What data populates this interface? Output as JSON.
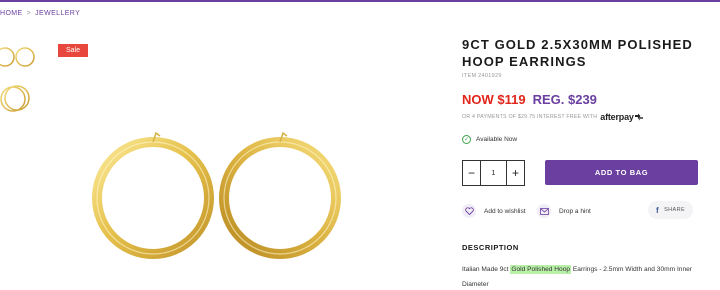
{
  "breadcrumb": {
    "home": "HOME",
    "separator": ">",
    "category": "JEWELLERY"
  },
  "badge": {
    "sale": "Sale"
  },
  "product": {
    "title": "9CT GOLD 2.5X30MM POLISHED HOOP EARRINGS",
    "item_number": "ITEM 2401929",
    "price_now": "NOW $119",
    "price_reg": "REG. $239",
    "afterpay_text": "OR 4 PAYMENTS OF $29.75 INTEREST FREE WITH",
    "afterpay_brand": "afterpay",
    "availability": "Available Now",
    "quantity": "1",
    "add_to_bag": "ADD TO BAG",
    "wishlist": "Add to wishlist",
    "hint": "Drop a hint",
    "share": "SHARE"
  },
  "description": {
    "heading": "DESCRIPTION",
    "prefix": "Italian Made 9ct ",
    "highlight": "Gold Polished Hoop",
    "suffix": " Earrings - 2.5mm Width and 30mm Inner Diameter"
  },
  "icons": {
    "check": "check-icon",
    "heart": "heart-icon",
    "envelope": "envelope-icon",
    "facebook": "facebook-icon",
    "minus": "minus-icon",
    "plus": "plus-icon"
  },
  "colors": {
    "brand_purple": "#6b3fa0",
    "sale_red": "#e8473d",
    "price_red": "#e1251b",
    "available_green": "#3fa34d",
    "highlight": "#b9f0a8"
  }
}
